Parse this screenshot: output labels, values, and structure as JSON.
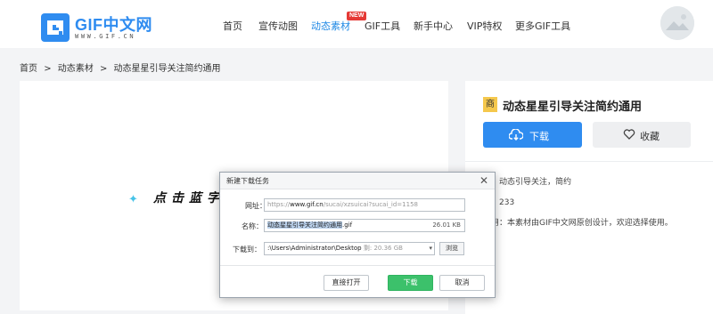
{
  "logo": {
    "text": "GIF中文网",
    "sub": "WWW.GIF.CN"
  },
  "nav": {
    "items": [
      "首页",
      "宣传动图",
      "动态素材",
      "GIF工具",
      "新手中心",
      "VIP特权",
      "更多GIF工具"
    ],
    "new_badge": "NEW"
  },
  "breadcrumb": [
    "首页",
    ">",
    "动态素材",
    ">",
    "动态星星引导关注简约通用"
  ],
  "preview": {
    "text": "点击蓝字"
  },
  "panel": {
    "category_badge": "商",
    "title": "动态星星引导关注简约通用",
    "download_label": "下载",
    "favorite_label": "收藏",
    "meta": [
      "类：动态引导关注，简约",
      "度：233",
      "商用：本素材由GIF中文网原创设计，欢迎选择使用。"
    ]
  },
  "dialog": {
    "title": "新建下载任务",
    "url_label": "网址：",
    "url_prefix": "https://",
    "url_host": "www.gif.cn",
    "url_rest": "/sucai/xzsuicai?sucai_id=1158",
    "name_label": "名称：",
    "name_selected": "动态星星引导关注简约通用",
    "name_ext": ".gif",
    "size": "26.01 KB",
    "saveto_label": "下载到：",
    "path": ":\\Users\\Administrator\\Desktop",
    "free_space": "剩: 20.36 GB",
    "browse_label": "浏览",
    "open_label": "直接打开",
    "download_label": "下载",
    "cancel_label": "取消"
  },
  "colors": {
    "accent": "#2f8cf0",
    "nav_active": "#1e88e5",
    "badge_new": "#e53935",
    "download_green": "#3cc16b",
    "category_badge": "#f5c84c"
  }
}
